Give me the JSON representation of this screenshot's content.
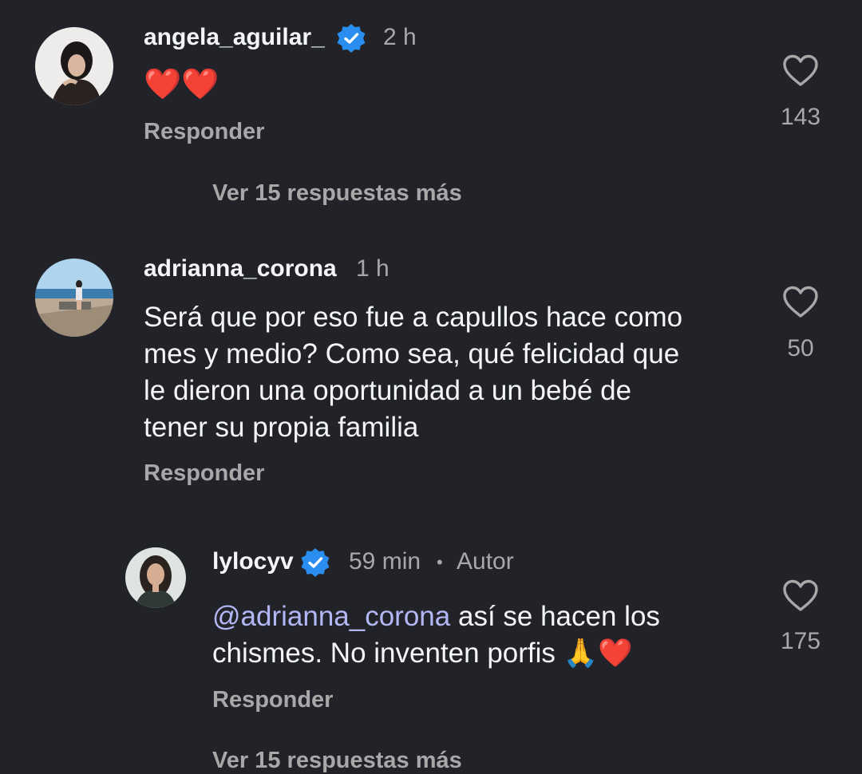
{
  "comments": [
    {
      "username": "angela_aguilar_",
      "verified": true,
      "time": "2 h",
      "text": "❤️❤️",
      "likes": "143",
      "reply_label": "Responder",
      "view_more": "Ver 15 respuestas más"
    },
    {
      "username": "adrianna_corona",
      "verified": false,
      "time": "1 h",
      "text_lines": [
        "Será que por eso fue a capullos hace como",
        "mes y medio? Como sea, qué felicidad que",
        "le dieron una oportunidad a un bebé de",
        "tener su propia familia"
      ],
      "likes": "50",
      "reply_label": "Responder"
    }
  ],
  "reply": {
    "username": "lylocyv",
    "verified": true,
    "time": "59 min",
    "separator": "•",
    "author_tag": "Autor",
    "mention": "@adrianna_corona",
    "text_after_mention": " así se hacen los",
    "text_line2": "chismes. No inventen porfis 🙏❤️",
    "likes": "175",
    "reply_label": "Responder",
    "view_more": "Ver 15 respuestas más"
  },
  "icons": {
    "heart": "heart-outline-icon",
    "verified": "verified-badge-icon"
  },
  "colors": {
    "background": "#212328",
    "primary_text": "#f3f5f7",
    "secondary_text": "#a8a8a8",
    "verified_blue": "#2a8ef0",
    "mention": "#b4b7f5"
  }
}
